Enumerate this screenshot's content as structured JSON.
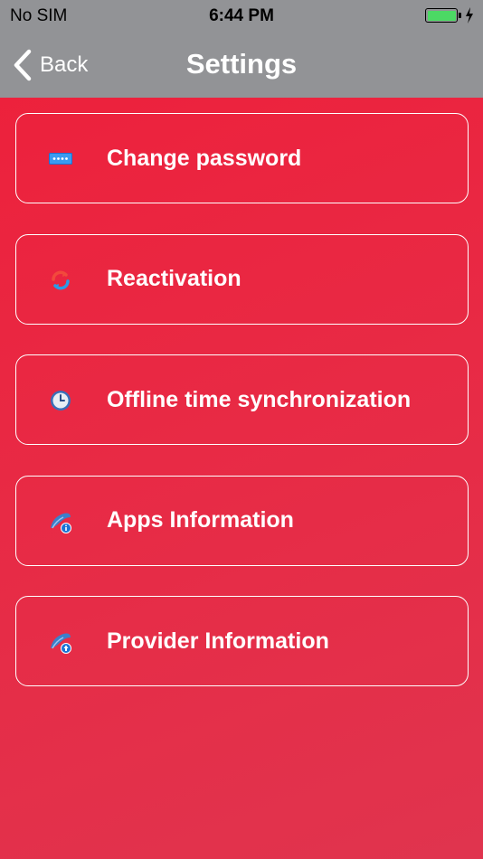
{
  "status_bar": {
    "carrier": "No SIM",
    "time": "6:44 PM",
    "battery_color": "#4cd964"
  },
  "nav": {
    "back_label": "Back",
    "title": "Settings",
    "bar_color": "#929396"
  },
  "menu": {
    "items": [
      {
        "label": "Change password",
        "icon": "password-icon"
      },
      {
        "label": "Reactivation",
        "icon": "refresh-icon"
      },
      {
        "label": "Offline time synchronization",
        "icon": "clock-icon"
      },
      {
        "label": "Apps Information",
        "icon": "app-info-icon"
      },
      {
        "label": "Provider Information",
        "icon": "provider-info-icon"
      }
    ]
  },
  "colors": {
    "background": "#e82a45",
    "icon_blue": "#1e88d9"
  }
}
